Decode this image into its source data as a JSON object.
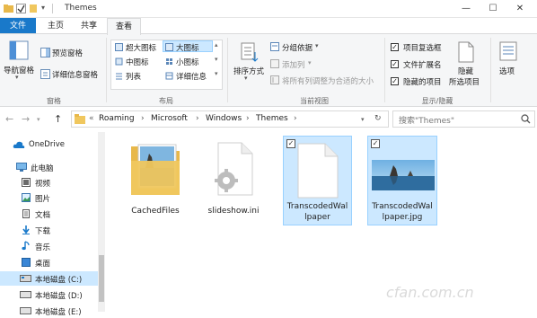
{
  "window": {
    "title": "Themes",
    "controls": [
      "—",
      "☐",
      "✕"
    ]
  },
  "ribbon_tabs": [
    {
      "label": "文件"
    },
    {
      "label": "主页"
    },
    {
      "label": "共享"
    },
    {
      "label": "查看"
    }
  ],
  "ribbon": {
    "panes": {
      "nav_pane": "导航窗格",
      "preview_pane": "预览窗格",
      "details_pane": "详细信息窗格",
      "group_label": "窗格"
    },
    "layout": {
      "xlarge_icons": "超大图标",
      "large_icons": "大图标",
      "medium_icons": "中图标",
      "small_icons": "小图标",
      "list": "列表",
      "details": "详细信息",
      "group_label": "布局"
    },
    "current_view": {
      "sort_by": "排序方式",
      "group_by": "分组依据",
      "add_columns": "添加列",
      "size_columns": "将所有列调整为合适的大小",
      "group_label": "当前视图"
    },
    "show_hide": {
      "item_checkboxes": "项目复选框",
      "file_extensions": "文件扩展名",
      "hidden_items": "隐藏的项目",
      "hide_selected_1": "隐藏",
      "hide_selected_2": "所选项目",
      "group_label": "显示/隐藏"
    },
    "options": "选项"
  },
  "address": {
    "crumbs": [
      "Roaming",
      "Microsoft",
      "Windows",
      "Themes"
    ],
    "overflow": "«",
    "search_placeholder": "搜索\"Themes\""
  },
  "sidebar": {
    "items": [
      {
        "label": "OneDrive"
      },
      {
        "label": "此电脑"
      },
      {
        "label": "视频"
      },
      {
        "label": "图片"
      },
      {
        "label": "文档"
      },
      {
        "label": "下载"
      },
      {
        "label": "音乐"
      },
      {
        "label": "桌面"
      },
      {
        "label": "本地磁盘 (C:)"
      },
      {
        "label": "本地磁盘 (D:)"
      },
      {
        "label": "本地磁盘 (E:)"
      }
    ]
  },
  "files": [
    {
      "name": "CachedFiles",
      "kind": "folder",
      "selected": false
    },
    {
      "name": "slideshow.ini",
      "kind": "settings-file",
      "selected": false
    },
    {
      "name_line1": "TranscodedWal",
      "name_line2": "lpaper",
      "kind": "blank-file",
      "selected": true
    },
    {
      "name_line1": "TranscodedWal",
      "name_line2": "lpaper.jpg",
      "kind": "image",
      "selected": true
    }
  ],
  "watermark": "cfan.com.cn",
  "colors": {
    "accent": "#1979ca",
    "selection": "#cce8ff",
    "selection_border": "#99d1ff",
    "folder": "#f0c75e"
  }
}
